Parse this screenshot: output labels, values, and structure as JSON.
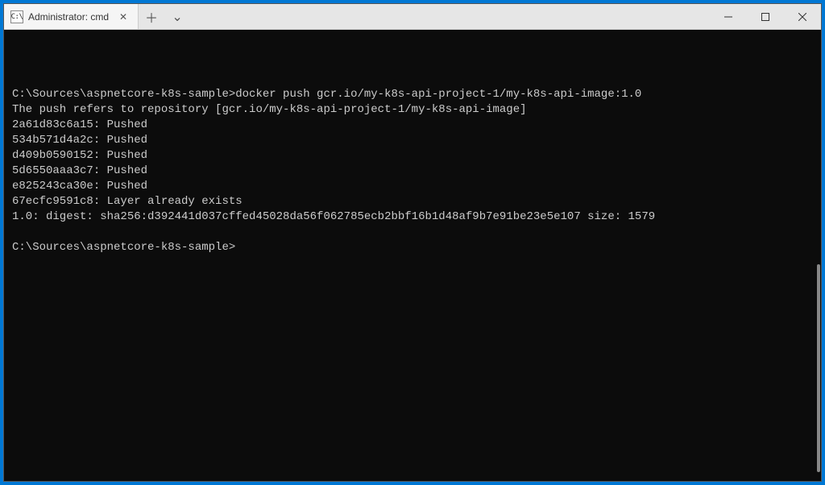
{
  "titlebar": {
    "tab_icon_text": "C:\\",
    "tab_title": "Administrator: cmd",
    "tab_close_glyph": "✕",
    "new_tab_glyph": "＋",
    "dropdown_glyph": "⌄"
  },
  "terminal": {
    "lines": [
      "",
      "C:\\Sources\\aspnetcore-k8s-sample>docker push gcr.io/my-k8s-api-project-1/my-k8s-api-image:1.0",
      "The push refers to repository [gcr.io/my-k8s-api-project-1/my-k8s-api-image]",
      "2a61d83c6a15: Pushed",
      "534b571d4a2c: Pushed",
      "d409b0590152: Pushed",
      "5d6550aaa3c7: Pushed",
      "e825243ca30e: Pushed",
      "67ecfc9591c8: Layer already exists",
      "1.0: digest: sha256:d392441d037cffed45028da56f062785ecb2bbf16b1d48af9b7e91be23e5e107 size: 1579",
      "",
      "C:\\Sources\\aspnetcore-k8s-sample>"
    ]
  }
}
